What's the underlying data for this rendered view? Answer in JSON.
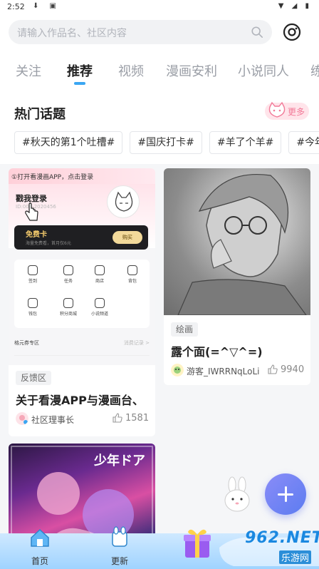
{
  "status_bar": {
    "time": "2:52",
    "left_icons": "⬇ ▣",
    "right_icons": "▼ ◢ ▮"
  },
  "search": {
    "placeholder": "请输入作品名、社区内容"
  },
  "tabs": [
    "关注",
    "推荐",
    "视频",
    "漫画安利",
    "小说同人",
    "练"
  ],
  "active_tab": "推荐",
  "hot_topics": {
    "title": "热门话题",
    "more_label": "更多",
    "chips": [
      "#秋天的第1个吐槽#",
      "#国庆打卡#",
      "#羊了个羊#",
      "#今年"
    ]
  },
  "feed": [
    {
      "screenshot": {
        "banner": "①打开看漫画APP，点击登录",
        "login": "戳我登录",
        "subline": "ID:000-2020456",
        "free_card": "免费卡",
        "free_card_sub": "海量免费看，首月仅6元",
        "buy": "购买",
        "grid": [
          "签到",
          "任务",
          "商店",
          "背包",
          "钱包",
          "积分商城",
          "小说频道"
        ],
        "section_left": "格元券专区",
        "section_right": "消费记录 >"
      },
      "tag": "反馈区",
      "title": "关于看漫APP与漫画台、",
      "author": "社区理事长",
      "likes": "1581"
    },
    {
      "tag": "绘画",
      "title": "露个面(=^▽^=)",
      "author": "游客_IWRRNqLoLi",
      "likes": "9940"
    },
    {
      "poster_text": "少年ドア"
    }
  ],
  "bottom_nav": [
    {
      "label": "首页"
    },
    {
      "label": "更新"
    }
  ],
  "watermark": {
    "brand": "962.NET",
    "sub": "乐游网"
  },
  "colors": {
    "accent": "#3aa6f2",
    "fab": "#6f80f4",
    "nav_bg": "#b8defd",
    "more_pink": "#f27a98"
  }
}
